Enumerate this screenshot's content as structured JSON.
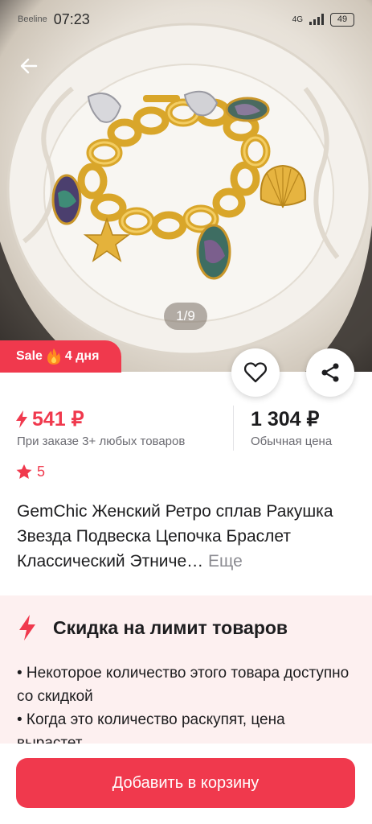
{
  "status_bar": {
    "carrier": "Beeline",
    "time": "07:23",
    "network": "4G",
    "battery": "49"
  },
  "gallery": {
    "counter": "1/9"
  },
  "sale_badge": {
    "label": "Sale",
    "days": "4 дня"
  },
  "price": {
    "promo_price": "541 ₽",
    "promo_condition": "При заказе 3+ любых товаров",
    "regular_price": "1 304 ₽",
    "regular_label": "Обычная цена"
  },
  "rating": {
    "value": "5"
  },
  "product": {
    "title": "GemChic Женский Ретро сплав Ракушка Звезда Подвеска Цепочка Браслет Классический Этниче…",
    "more_label": "Еще"
  },
  "limit_discount": {
    "title": "Скидка на лимит товаров",
    "line1": "• Некоторое количество этого товара доступно со скидкой",
    "line2": "• Когда это количество раскупят, цена вырастет"
  },
  "cart": {
    "button_label": "Добавить в корзину"
  },
  "colors": {
    "accent": "#f0394d",
    "limit_bg": "#fdf0f0"
  }
}
